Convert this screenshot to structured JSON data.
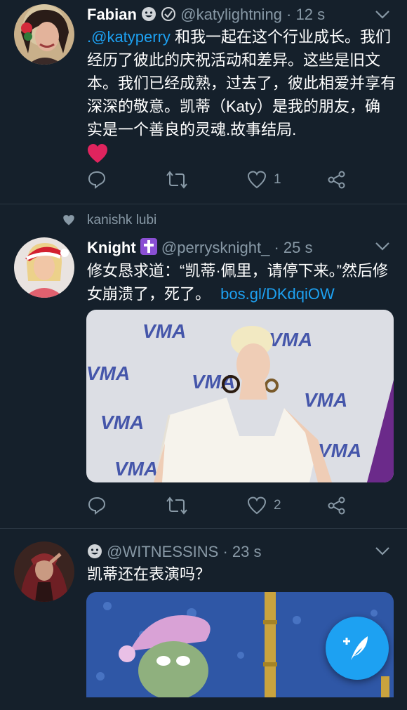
{
  "colors": {
    "background": "#15202b",
    "accent": "#1da1f2",
    "secondary_text": "#8899a6",
    "like_heart": "#e0245e",
    "divider": "#2a3642"
  },
  "tweets": [
    {
      "name": "Fabian",
      "name_badges": [
        "grinning-face-icon",
        "verified-style-icon"
      ],
      "handle": "@katylightning",
      "time": "· 12 s",
      "mention": ".@katyperry",
      "text": " 和我一起在这个行业成长。我们经历了彼此的庆祝活动和差异。这些是旧文本。我们已经成熟，过去了，彼此相爱并享有深深的敬意。凯蒂（Katy）是我的朋友，确实是一个善良的灵魂.故事结局.",
      "emoji": "red-heart-icon",
      "reply_count": "",
      "retweet_count": "",
      "like_count": "1"
    },
    {
      "social_context": "kanishk lubi",
      "name": "Knight",
      "name_badges": [
        "latin-cross-icon"
      ],
      "handle": "@perrysknight_",
      "time": "· 25 s",
      "text": "修女恳求道：“凯蒂·佩里，请停下来。”然后修女崩溃了，死了。",
      "link": "bos.gl/DKdqiOW",
      "media_backdrop_text": "VMA",
      "reply_count": "",
      "retweet_count": "",
      "like_count": "2"
    },
    {
      "name": "",
      "name_badges": [
        "grinning-face-icon"
      ],
      "handle": "@WITNESSINS",
      "time": "· 23 s",
      "text": "凯蒂还在表演吗？"
    }
  ],
  "compose_button": "compose-tweet-icon"
}
